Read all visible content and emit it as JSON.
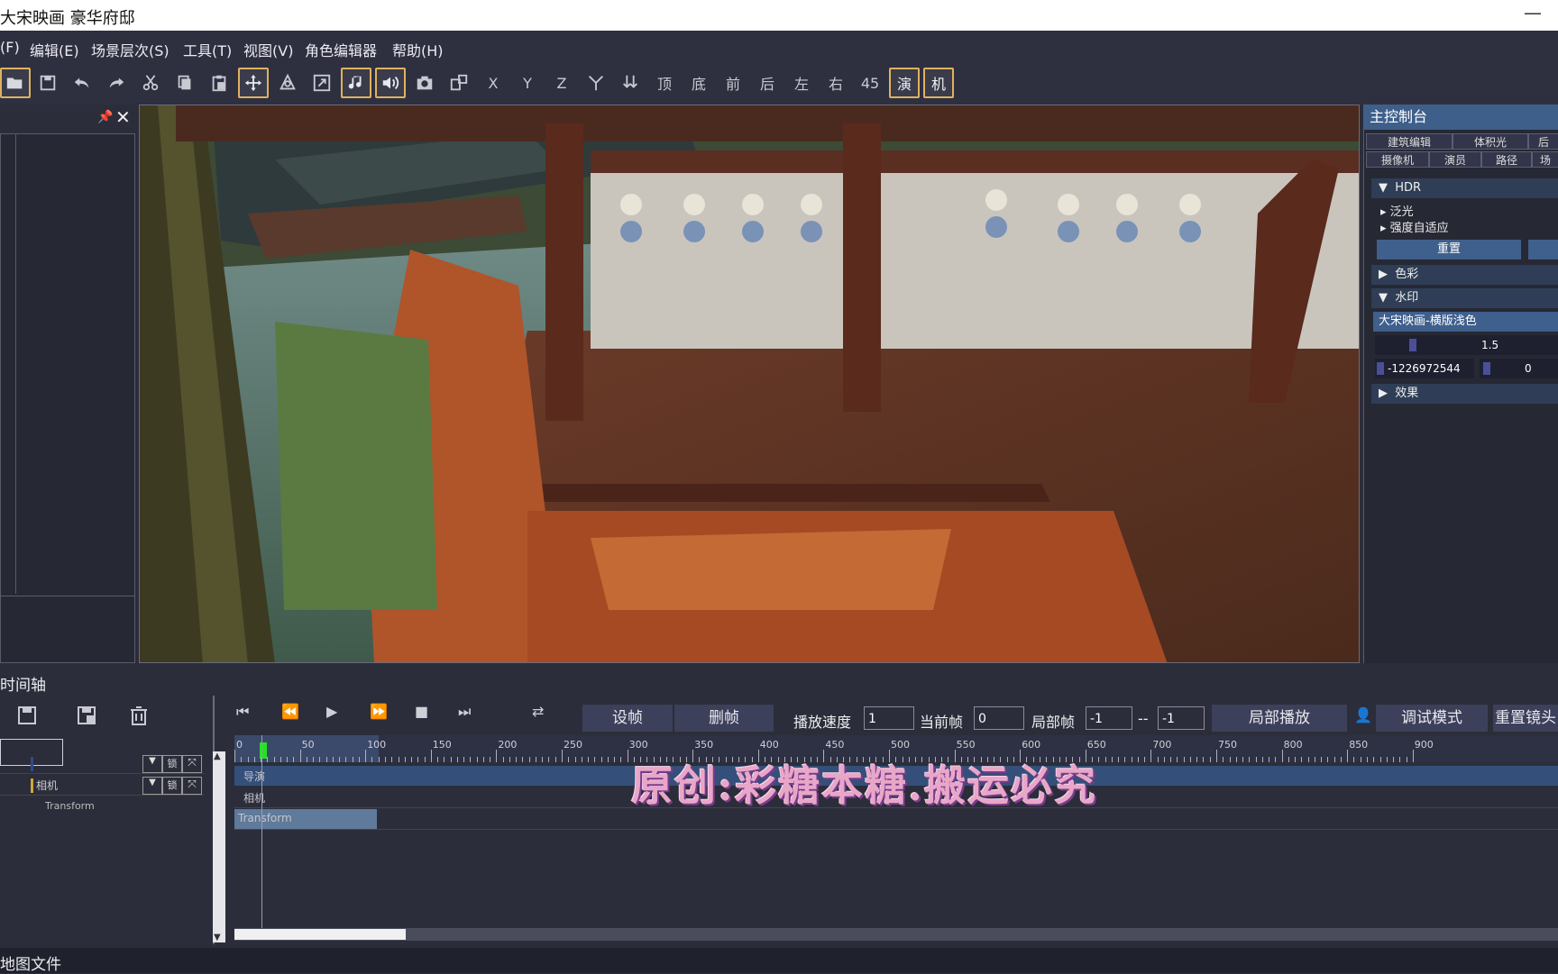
{
  "window": {
    "title": "大宋映画 豪华府邸",
    "min_icon": "—"
  },
  "menu": [
    "(F)",
    "编辑(E)",
    "场景层次(S)",
    "工具(T)",
    "视图(V)",
    "角色编辑器",
    "帮助(H)"
  ],
  "toolbar": {
    "axes": [
      "X",
      "Y",
      "Z"
    ],
    "views": [
      "顶",
      "底",
      "前",
      "后",
      "左",
      "右",
      "45"
    ],
    "toggle_act": "演",
    "toggle_cam": "机"
  },
  "rightpanel": {
    "title": "主控制台",
    "tabs_row1": [
      "建筑编辑",
      "体积光",
      "后"
    ],
    "tabs_row2": [
      "摄像机",
      "演员",
      "路径",
      "场"
    ],
    "hdr": "HDR",
    "hdr_items": [
      "泛光",
      "强度自适应"
    ],
    "reset": "重置",
    "color": "色彩",
    "watermark_sec": "水印",
    "watermark_value": "大宋映画-横版浅色",
    "scale_value": "1.5",
    "coord_value": "-1226972544",
    "coord_value2": "0",
    "effect": "效果"
  },
  "timeline": {
    "title": "时间轴",
    "set_frame": "设帧",
    "del_frame": "删帧",
    "speed_label": "播放速度",
    "speed_value": "1",
    "cur_label": "当前帧",
    "cur_value": "0",
    "local_label": "局部帧",
    "local_from": "-1",
    "local_sep": "--",
    "local_to": "-1",
    "local_play": "局部播放",
    "debug": "调试模式",
    "reset_cam": "重置镜头",
    "ruler_labels": [
      "0",
      "50",
      "100",
      "150",
      "200",
      "250",
      "300",
      "350",
      "400",
      "450",
      "500",
      "550",
      "600",
      "650",
      "700",
      "750",
      "800",
      "850",
      "900"
    ],
    "tracks": [
      {
        "name": "导演"
      },
      {
        "name": "相机"
      },
      {
        "name": "Transform"
      }
    ],
    "lock_label": "锁"
  },
  "watermark_text": "原创:彩糖本糖.搬运必究",
  "status": "地图文件"
}
